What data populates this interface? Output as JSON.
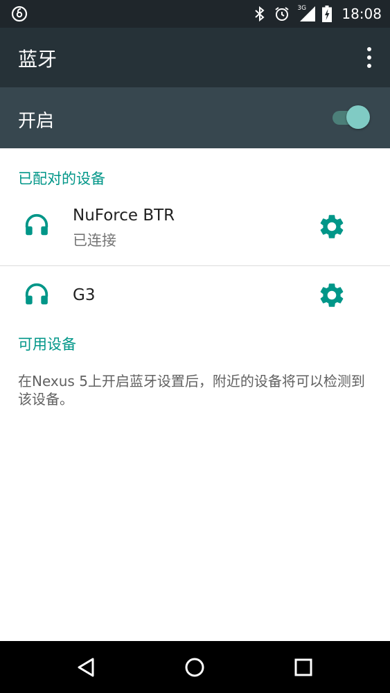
{
  "status_bar": {
    "left_icon": "netease-music-icon",
    "icons": [
      "bluetooth-icon",
      "alarm-icon",
      "signal-icon",
      "battery-charging-icon"
    ],
    "network": "3G",
    "time": "18:08"
  },
  "app_bar": {
    "title": "蓝牙",
    "menu_icon": "more-vert-icon"
  },
  "switch_bar": {
    "label": "开启",
    "on": true
  },
  "paired": {
    "header": "已配对的设备",
    "devices": [
      {
        "name": "NuForce BTR",
        "status": "已连接",
        "icon": "headphones-icon",
        "action_icon": "gear-icon"
      },
      {
        "name": "G3",
        "status": "",
        "icon": "headphones-icon",
        "action_icon": "gear-icon"
      }
    ]
  },
  "available": {
    "header": "可用设备",
    "info": "在Nexus 5上开启蓝牙设置后，附近的设备将可以检测到该设备。"
  },
  "nav_bar": {
    "buttons": [
      "back-icon",
      "home-icon",
      "recents-icon"
    ]
  },
  "colors": {
    "accent": "#009688",
    "app_bar": "#263238",
    "switch_bar": "#37474f",
    "status_bar": "#1f262b"
  }
}
